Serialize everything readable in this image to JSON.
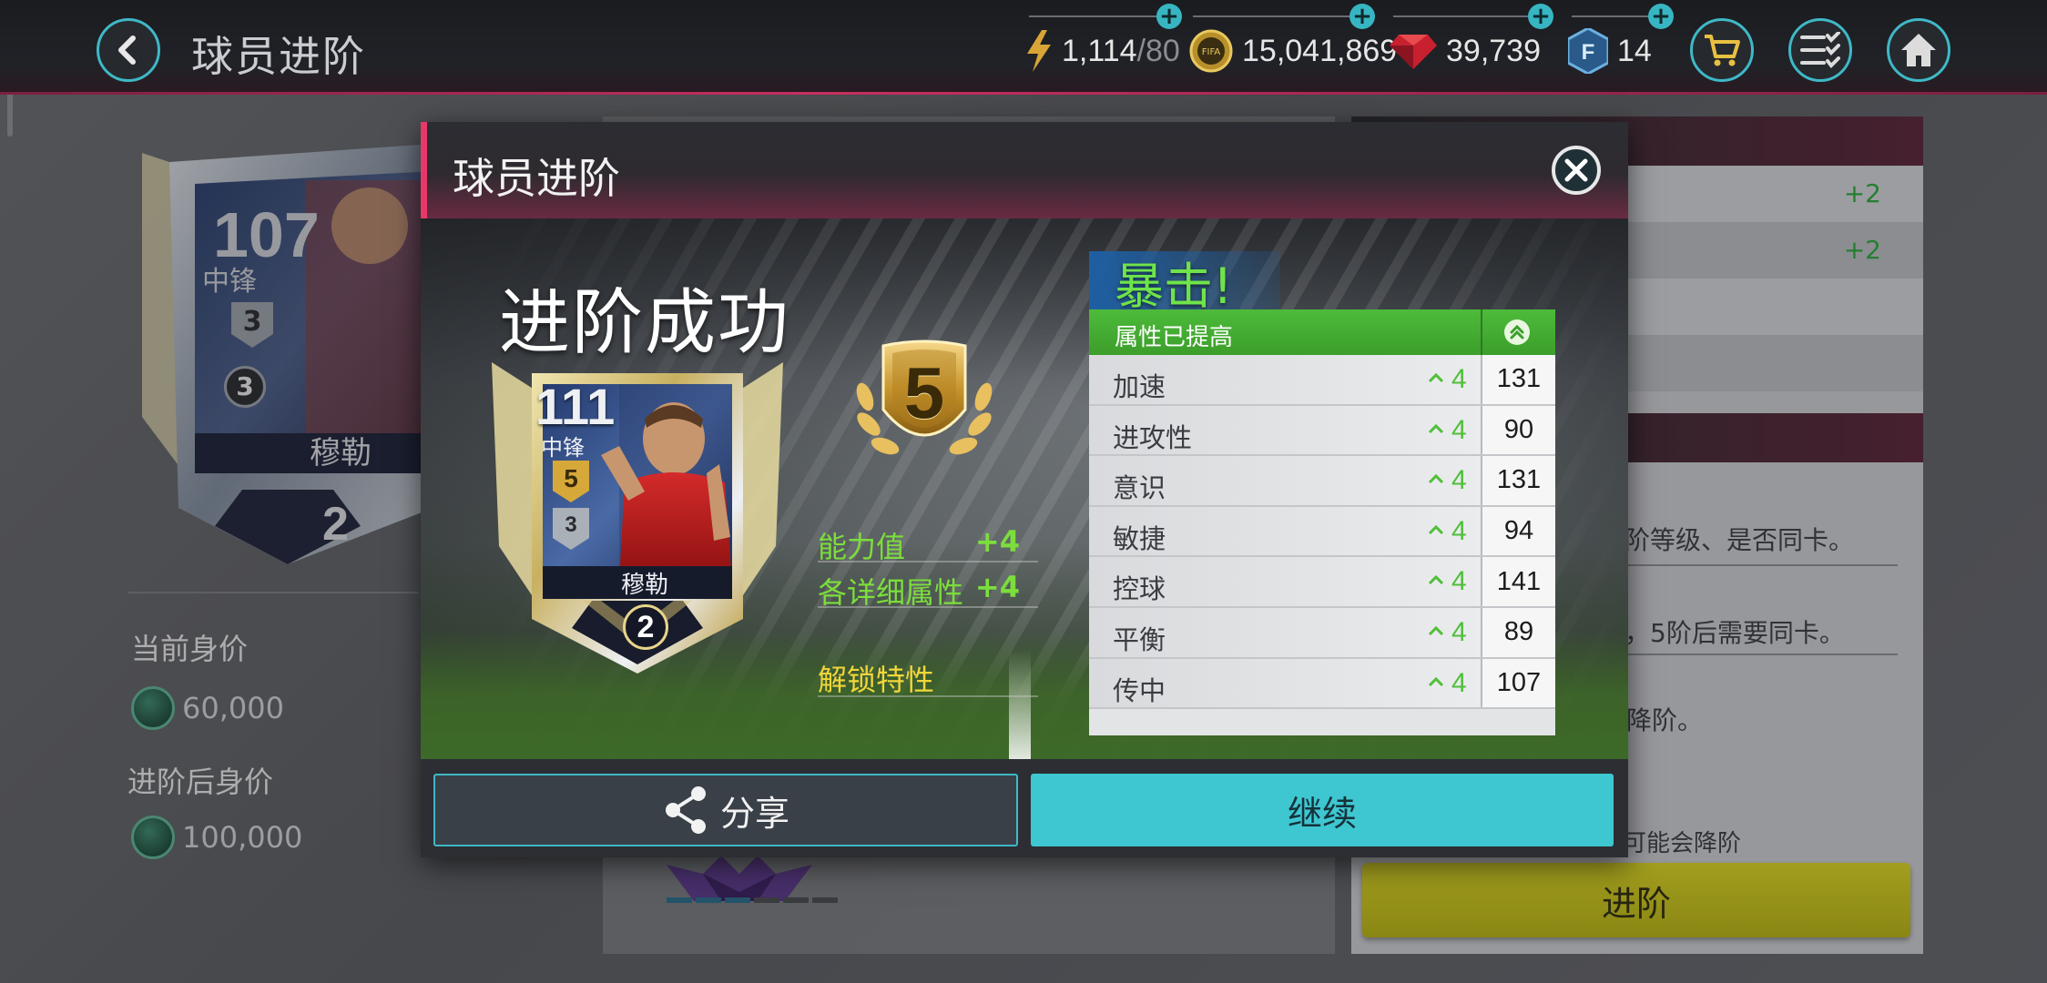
{
  "header": {
    "title": "球员进阶",
    "resources": {
      "energy": {
        "value": "1,114",
        "max": "/80"
      },
      "coins": {
        "value": "15,041,869",
        "icon_text": "FIFA"
      },
      "gems": {
        "value": "39,739"
      },
      "fifa_points": {
        "value": "14",
        "icon_text": "F"
      }
    }
  },
  "background": {
    "card": {
      "rating": "107",
      "position": "中锋",
      "rank": "3",
      "name": "穆勒",
      "level": "2"
    },
    "current_value_label": "当前身价",
    "current_value": "60,000",
    "upgraded_value_label": "进阶后身价",
    "upgraded_value": "100,000",
    "right_panel": {
      "row_values": [
        "+2",
        "+2"
      ],
      "text_1": "阶等级、是否同卡。",
      "text_2": "，5阶后需要同卡。",
      "text_3": "降阶。",
      "text_4": "可能会降阶",
      "upgrade_button": "进阶"
    }
  },
  "modal": {
    "title": "球员进阶",
    "success_title": "进阶成功",
    "card": {
      "rating": "111",
      "position": "中锋",
      "rank_gold": "5",
      "rank": "3",
      "name": "穆勒",
      "level": "2"
    },
    "badge_rank": "5",
    "stats": [
      {
        "label": "能力值",
        "value": "+4"
      },
      {
        "label": "各详细属性",
        "value": "+4"
      }
    ],
    "unlock_label": "解锁特性",
    "crit_text": "暴击!",
    "attr_header": "属性已提高",
    "attributes": [
      {
        "name": "加速",
        "inc": "4",
        "value": "131"
      },
      {
        "name": "进攻性",
        "inc": "4",
        "value": "90"
      },
      {
        "name": "意识",
        "inc": "4",
        "value": "131"
      },
      {
        "name": "敏捷",
        "inc": "4",
        "value": "94"
      },
      {
        "name": "控球",
        "inc": "4",
        "value": "141"
      },
      {
        "name": "平衡",
        "inc": "4",
        "value": "89"
      },
      {
        "name": "传中",
        "inc": "4",
        "value": "107"
      }
    ],
    "share_label": "分享",
    "continue_label": "继续"
  },
  "colors": {
    "accent_teal": "#3ec7d1",
    "accent_pink": "#e8386a",
    "stat_green": "#7cde3c",
    "unlock_yellow": "#f2d63a",
    "upgrade_yellow": "#d9d321"
  },
  "icons": [
    "back-arrow-icon",
    "lightning-icon",
    "fifa-coin-icon",
    "gem-icon",
    "fifa-points-icon",
    "cart-icon",
    "checklist-icon",
    "home-icon",
    "close-icon",
    "share-icon",
    "chevron-up-icon"
  ]
}
